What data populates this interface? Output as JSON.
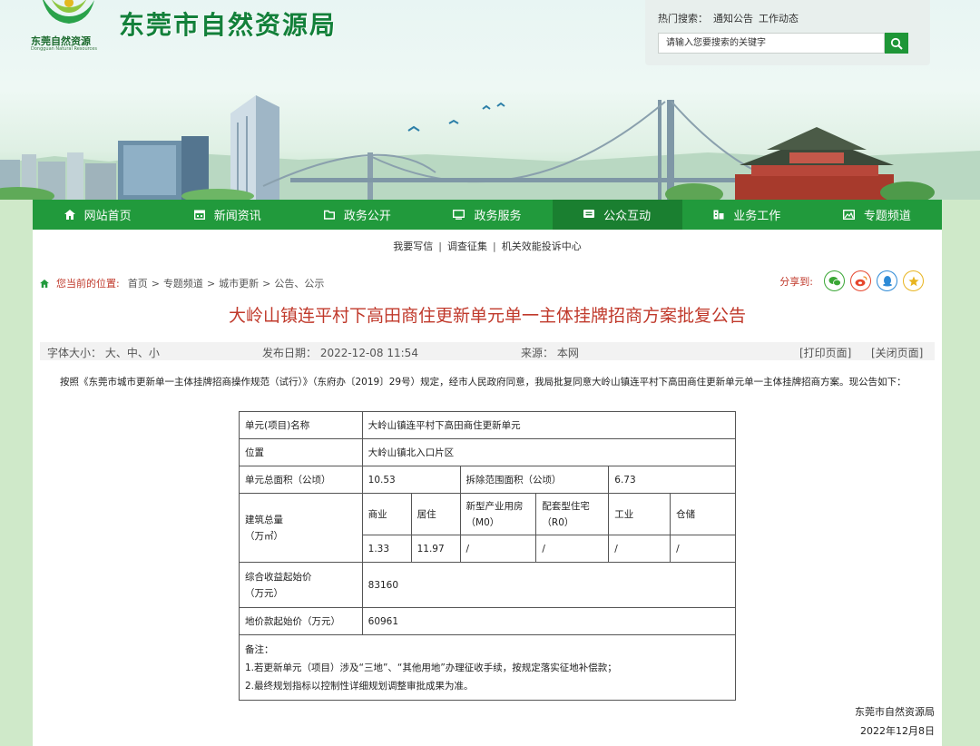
{
  "header": {
    "logo_text": "东莞自然资源",
    "logo_sub": "Dongguan Natural Resources",
    "site_title": "东莞市自然资源局",
    "hot_label": "热门搜索：",
    "hot_keywords": [
      "通知公告",
      "工作动态"
    ],
    "search_placeholder": "请输入您要搜索的关键字"
  },
  "nav": [
    {
      "label": "网站首页",
      "icon": "home-icon"
    },
    {
      "label": "新闻资讯",
      "icon": "calendar-icon"
    },
    {
      "label": "政务公开",
      "icon": "folder-icon"
    },
    {
      "label": "政务服务",
      "icon": "monitor-icon"
    },
    {
      "label": "公众互动",
      "icon": "chat-icon"
    },
    {
      "label": "业务工作",
      "icon": "building-icon"
    },
    {
      "label": "专题频道",
      "icon": "image-icon"
    }
  ],
  "sublinks": [
    "我要写信",
    "调查征集",
    "机关效能投诉中心"
  ],
  "breadcrumb": {
    "label": "您当前的位置:",
    "items": [
      "首页",
      "专题频道",
      "城市更新",
      "公告、公示"
    ]
  },
  "share_label": "分享到:",
  "article": {
    "title": "大岭山镇连平村下高田商住更新单元单一主体挂牌招商方案批复公告",
    "font_size": "字体大小： 大、中、小",
    "date": "发布日期： 2022-12-08 11:54",
    "source": "来源： 本网",
    "print": "[打印页面]",
    "close": "[关闭页面]",
    "body": "按照《东莞市城市更新单一主体挂牌招商操作规范（试行）》（东府办〔2019〕29号）规定，经市人民政府同意，我局批复同意大岭山镇连平村下高田商住更新单元单一主体挂牌招商方案。现公告如下：",
    "sign_org": "东莞市自然资源局",
    "sign_date": "2022年12月8日"
  },
  "table": {
    "unit_name_label": "单元(项目)名称",
    "unit_name": "大岭山镇连平村下高田商住更新单元",
    "location_label": "位置",
    "location": "大岭山镇北入口片区",
    "total_area_label": "单元总面积（公顷）",
    "total_area": "10.53",
    "demolition_area_label": "拆除范围面积（公顷）",
    "demolition_area": "6.73",
    "building_label_1": "建筑总量",
    "building_label_2": "（万㎡）",
    "building_headers": [
      "商业",
      "居住",
      "新型产业用房（M0）",
      "配套型住宅（R0）",
      "工业",
      "仓储"
    ],
    "building_values": [
      "1.33",
      "11.97",
      "/",
      "/",
      "/",
      "/"
    ],
    "income_label_1": "综合收益起始价",
    "income_label_2": "（万元）",
    "income_value": "83160",
    "land_label": "地价款起始价（万元）",
    "land_value": "60961",
    "notes_title": "备注：",
    "notes": [
      "1.若更新单元（项目）涉及“三地”、“其他用地”办理征收手续，按规定落实征地补偿款；",
      "2.最终规划指标以控制性详细规划调整审批成果为准。"
    ]
  }
}
